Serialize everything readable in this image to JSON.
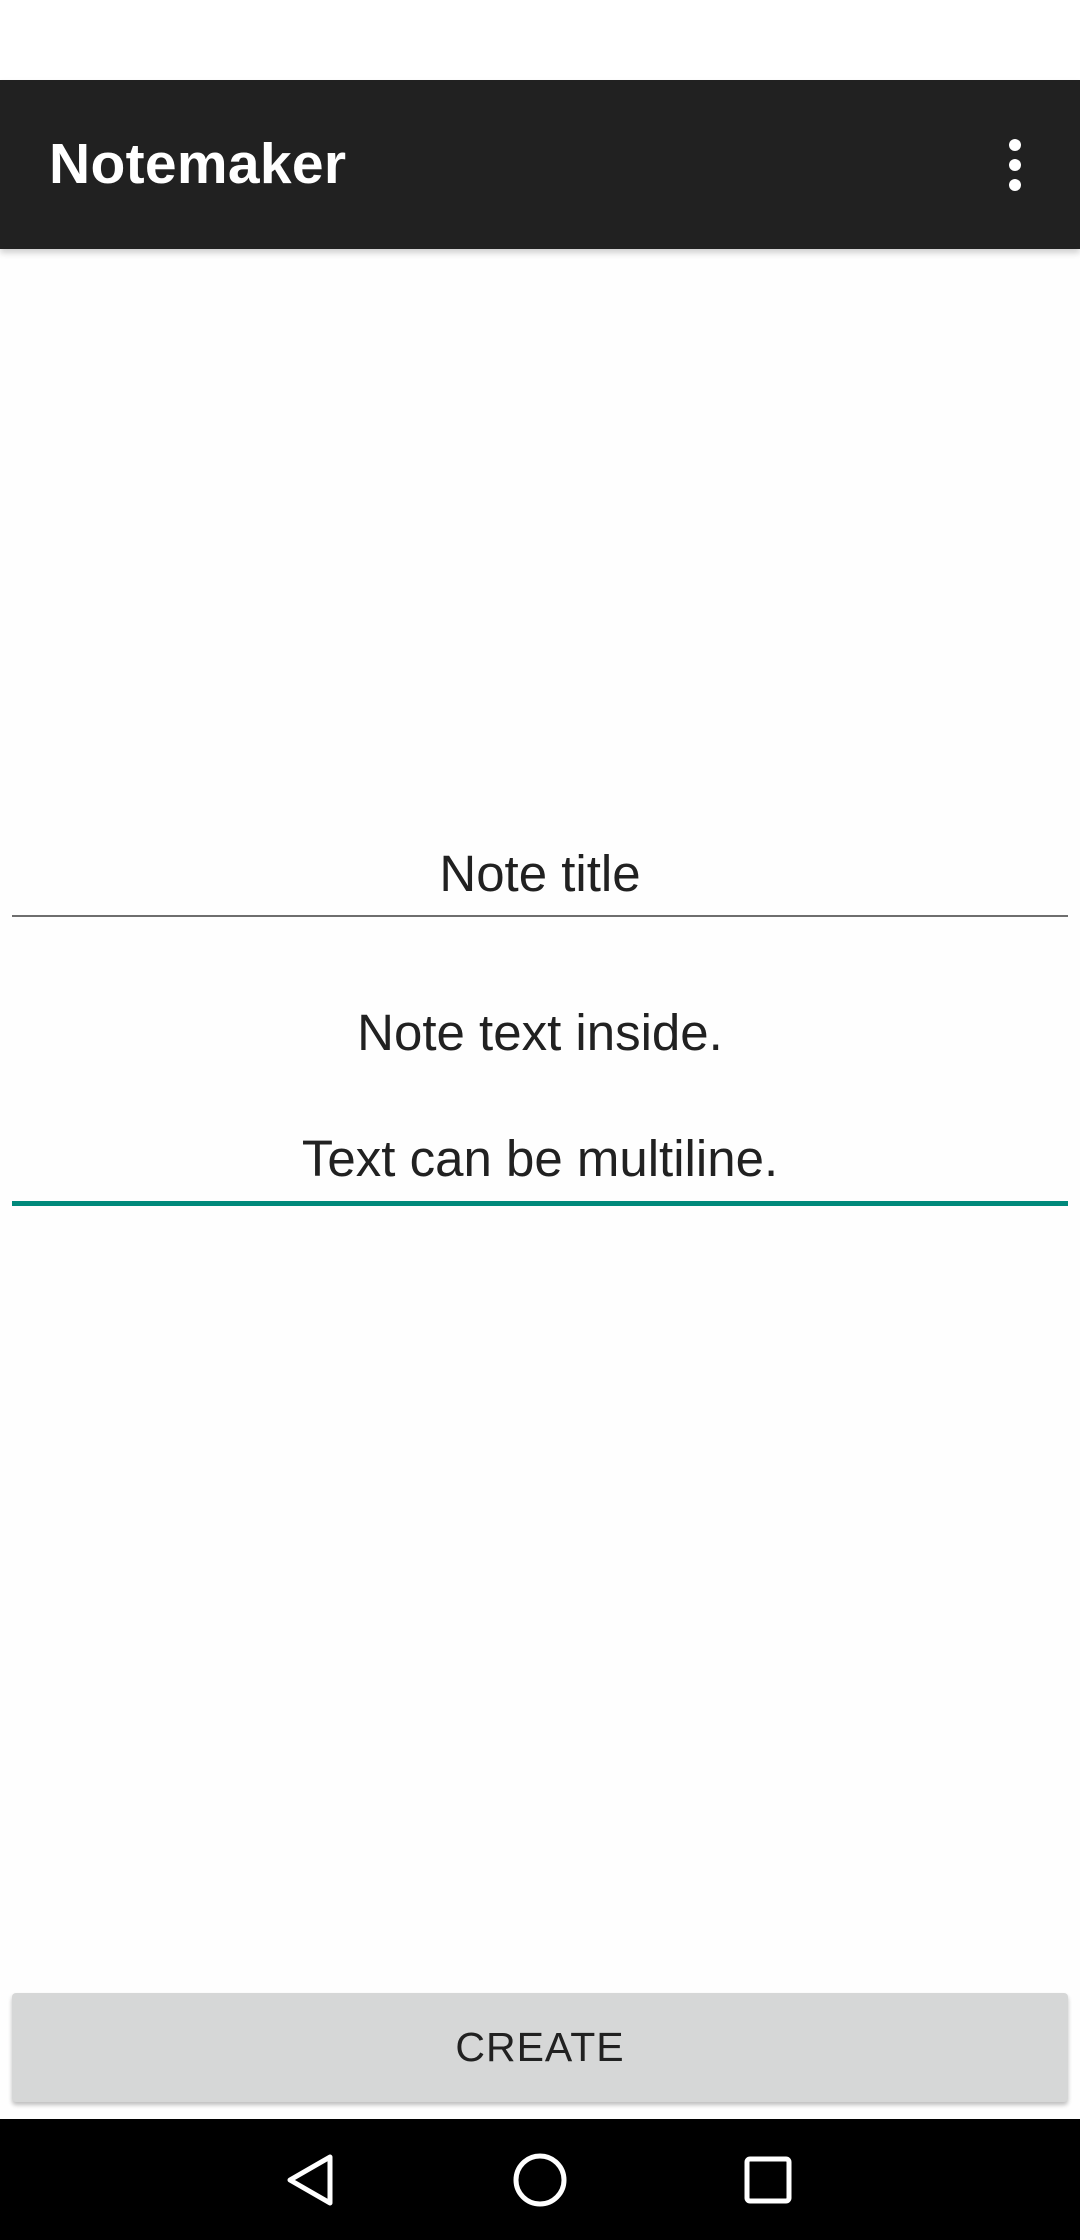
{
  "app_bar": {
    "title": "Notemaker",
    "overflow_icon": "more-vert-icon",
    "background": "#212121"
  },
  "form": {
    "title_field": {
      "value": "Note title"
    },
    "body_field": {
      "lines": [
        "Note text inside.",
        "Text can be multiline."
      ],
      "focused": true,
      "accent": "#00897b"
    }
  },
  "actions": {
    "create_label": "CREATE"
  },
  "nav_bar": {
    "buttons": [
      "back-icon",
      "home-icon",
      "recents-icon"
    ]
  }
}
